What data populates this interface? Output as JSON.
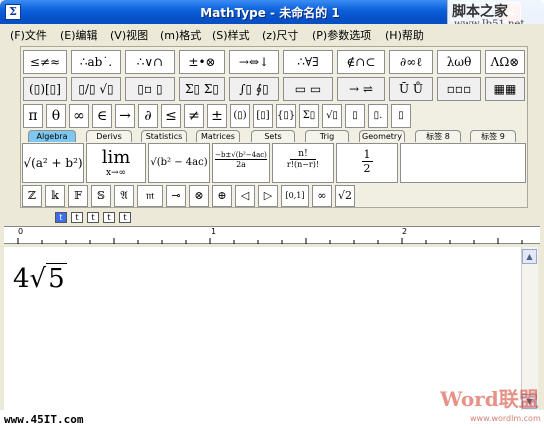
{
  "window": {
    "title": "MathType - 未命名的 1",
    "icon": "mathtype-app-icon",
    "controls": {
      "minimize": "_",
      "maximize": "□",
      "close": "×"
    }
  },
  "watermark_top": {
    "brand": "脚本之家",
    "url": "www.Jb51.net"
  },
  "menu": [
    "(F)文件",
    "(E)编辑",
    "(V)视图",
    "(m)格式",
    "(S)样式",
    "(z)尺寸",
    "(P)参数选项",
    "(H)帮助"
  ],
  "palette_row1": [
    "≤≠≈",
    "∴ab˙.",
    "∴∨∩",
    "±•⊗",
    "→⇔↓",
    "∴∀∃",
    "∉∩⊂",
    "∂∞ℓ",
    "λωθ",
    "ΛΩ⊗"
  ],
  "palette_row2": [
    "(▯)[▯]",
    "▯/▯ √▯",
    "▯▫ ▯",
    "Σ▯ Σ▯",
    "∫▯ ∮▯",
    "▭ ▭",
    "→ ⇌",
    "Ū Ů",
    "▫▫▫",
    "▦▦"
  ],
  "symbol_row": [
    "π",
    "θ",
    "∞",
    "∈",
    "→",
    "∂",
    "≤",
    "≠",
    "±",
    "(▯)",
    "[▯]",
    "{▯}",
    "Σ▯",
    "√▯",
    "▯",
    "▯.",
    "▯"
  ],
  "tabs": [
    "Algebra",
    "Derivs",
    "Statistics",
    "Matrices",
    "Sets",
    "Trig",
    "Geometry",
    "标签 8",
    "标签 9"
  ],
  "active_tab": "Algebra",
  "templates": {
    "t1_sqrt": "√(a² + b²)",
    "t2_lim": "lim",
    "t2_sub": "x→∞",
    "t3": "√(b² − 4ac)",
    "t4_num": "−b±√(b²−4ac)",
    "t4_den": "2a",
    "t5_num": "n!",
    "t5_den": "r!(n−r)!",
    "t6_num": "1",
    "t6_den": "2"
  },
  "bottom_symbols": [
    "ℤ",
    "𝕜",
    "𝔽",
    "𝕊",
    "𝔄",
    "𝔪",
    "⊸",
    "⊗",
    "⊕",
    "◁",
    "▷",
    "[0,1]",
    "∞",
    "√2"
  ],
  "small_toolbar": [
    "t",
    "t",
    "t",
    "t",
    "t"
  ],
  "ruler_labels": [
    "0",
    "1",
    "2"
  ],
  "document": {
    "coefficient": "4",
    "radicand": "5"
  },
  "watermark_bottom": {
    "left": "www.45IT.com",
    "right": "Word联盟",
    "right_small": "www.wordlm.com"
  }
}
